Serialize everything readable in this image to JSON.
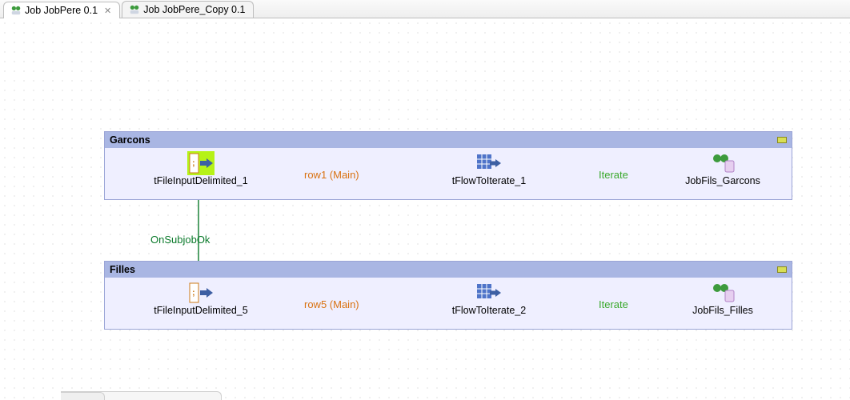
{
  "tabs": [
    {
      "label": "Job JobPere 0.1",
      "active": true,
      "closeable": true
    },
    {
      "label": "Job JobPere_Copy 0.1",
      "active": false,
      "closeable": false
    }
  ],
  "subjobs": {
    "garcons": {
      "title": "Garcons",
      "nodes": {
        "input": {
          "label": "tFileInputDelimited_1"
        },
        "iterate": {
          "label": "tFlowToIterate_1"
        },
        "child": {
          "label": "JobFils_Garcons"
        }
      },
      "links": {
        "main": "row1 (Main)",
        "iterate": "Iterate"
      }
    },
    "filles": {
      "title": "Filles",
      "nodes": {
        "input": {
          "label": "tFileInputDelimited_5"
        },
        "iterate": {
          "label": "tFlowToIterate_2"
        },
        "child": {
          "label": "JobFils_Filles"
        }
      },
      "links": {
        "main": "row5 (Main)",
        "iterate": "Iterate"
      }
    },
    "between_link": "OnSubjobOk"
  }
}
